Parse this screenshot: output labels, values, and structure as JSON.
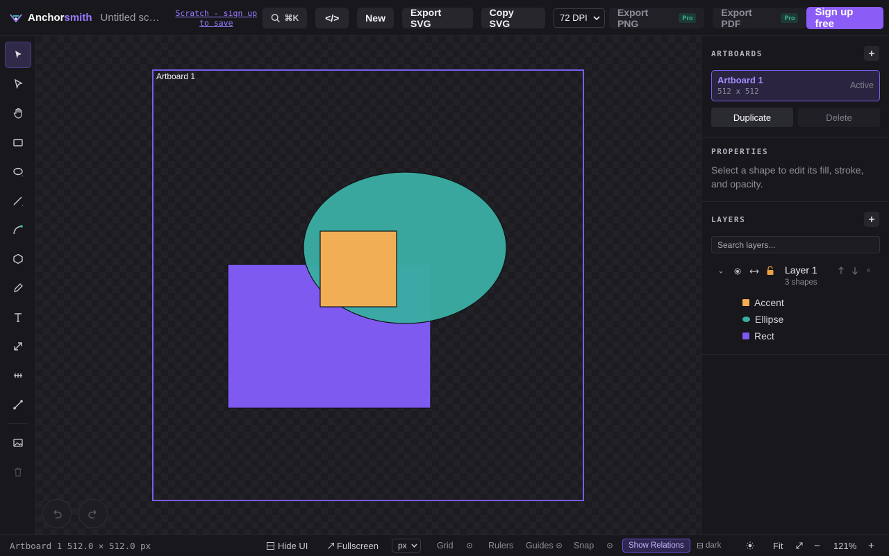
{
  "header": {
    "logo_part1": "Anchor",
    "logo_part2": "smith",
    "document_title": "Untitled scratch",
    "scratch_link": "Scratch - sign up to save",
    "search_shortcut": "⌘K",
    "code_button": "</>",
    "new_button": "New",
    "export_svg": "Export SVG",
    "copy_svg": "Copy SVG",
    "dpi_value": "72 DPI",
    "export_png": "Export PNG",
    "export_pdf": "Export PDF",
    "pro_badge": "Pro",
    "signup": "Sign up free"
  },
  "tools": [
    "select-tool",
    "direct-select-tool",
    "hand-tool",
    "rectangle-tool",
    "ellipse-tool",
    "line-tool",
    "curve-tool",
    "polygon-tool",
    "pen-tool",
    "text-tool",
    "scale-tool",
    "distribute-tool",
    "path-tool",
    "image-tool",
    "delete-tool"
  ],
  "canvas": {
    "artboard_label": "Artboard 1",
    "shapes": [
      {
        "name": "Rect",
        "type": "rect",
        "fill": "#7f5af0"
      },
      {
        "name": "Ellipse",
        "type": "ellipse",
        "fill": "#3aada3"
      },
      {
        "name": "Accent",
        "type": "rect",
        "fill": "#f2ae55"
      }
    ]
  },
  "panel": {
    "artboards_title": "ARTBOARDS",
    "artboard": {
      "name": "Artboard 1",
      "size": "512 x 512",
      "status": "Active"
    },
    "duplicate": "Duplicate",
    "delete": "Delete",
    "properties_title": "PROPERTIES",
    "properties_desc": "Select a shape to edit its fill, stroke, and opacity.",
    "layers_title": "LAYERS",
    "search_placeholder": "Search layers...",
    "layer": {
      "name": "Layer 1",
      "count": "3 shapes"
    },
    "shapes": [
      {
        "name": "Accent",
        "color": "#f2ae55",
        "kind": "rect"
      },
      {
        "name": "Ellipse",
        "color": "#3aada3",
        "kind": "ellipse"
      },
      {
        "name": "Rect",
        "color": "#7f5af0",
        "kind": "rect"
      }
    ]
  },
  "status": {
    "info": "Artboard 1 512.0 × 512.0 px",
    "hide_ui": "Hide UI",
    "fullscreen": "Fullscreen",
    "units": "px",
    "grid": "Grid",
    "rulers": "Rulers",
    "guides": "Guides",
    "snap": "Snap",
    "show_relations": "Show Relations",
    "theme": "dark",
    "fit": "Fit",
    "zoom": "121%"
  }
}
